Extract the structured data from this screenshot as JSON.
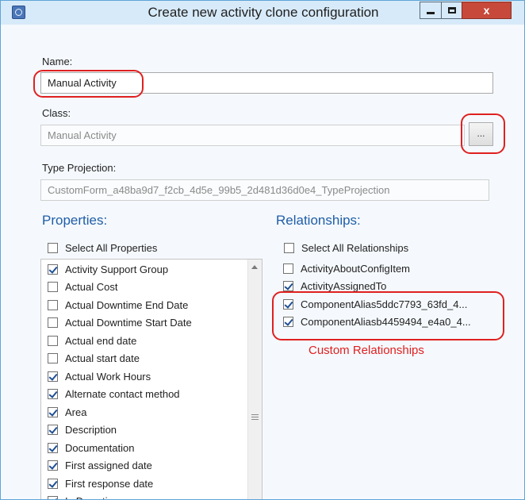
{
  "window": {
    "title": "Create new activity clone configuration",
    "min_label": "–",
    "max_label": "☐",
    "close_label": "x"
  },
  "form": {
    "name_label": "Name:",
    "name_value": "Manual Activity",
    "class_label": "Class:",
    "class_value": "Manual Activity",
    "browse_label": "...",
    "type_projection_label": "Type Projection:",
    "type_projection_value": "CustomForm_a48ba9d7_f2cb_4d5e_99b5_2d481d36d0e4_TypeProjection"
  },
  "properties": {
    "header": "Properties:",
    "select_all": {
      "label": "Select All Properties",
      "checked": false
    },
    "items": [
      {
        "label": "Activity Support Group",
        "checked": true
      },
      {
        "label": "Actual Cost",
        "checked": false
      },
      {
        "label": "Actual Downtime End Date",
        "checked": false
      },
      {
        "label": "Actual Downtime Start Date",
        "checked": false
      },
      {
        "label": "Actual end date",
        "checked": false
      },
      {
        "label": "Actual start date",
        "checked": false
      },
      {
        "label": "Actual Work Hours",
        "checked": true
      },
      {
        "label": "Alternate contact method",
        "checked": true
      },
      {
        "label": "Area",
        "checked": true
      },
      {
        "label": "Description",
        "checked": true
      },
      {
        "label": "Documentation",
        "checked": true
      },
      {
        "label": "First assigned date",
        "checked": true
      },
      {
        "label": "First response date",
        "checked": true
      },
      {
        "label": "Is Downtime",
        "checked": true
      }
    ]
  },
  "relationships": {
    "header": "Relationships:",
    "select_all": {
      "label": "Select All Relationships",
      "checked": false
    },
    "items": [
      {
        "label": "ActivityAboutConfigItem",
        "checked": false
      },
      {
        "label": "ActivityAssignedTo",
        "checked": true
      },
      {
        "label": "ComponentAlias5ddc7793_63fd_4...",
        "checked": true
      },
      {
        "label": "ComponentAliasb4459494_e4a0_4...",
        "checked": true
      }
    ]
  },
  "annotation": {
    "text": "Custom Relationships",
    "color": "#e02020"
  },
  "colors": {
    "accent": "#1f5da8",
    "titlebar": "#d7eaf9",
    "close": "#c7493a"
  }
}
